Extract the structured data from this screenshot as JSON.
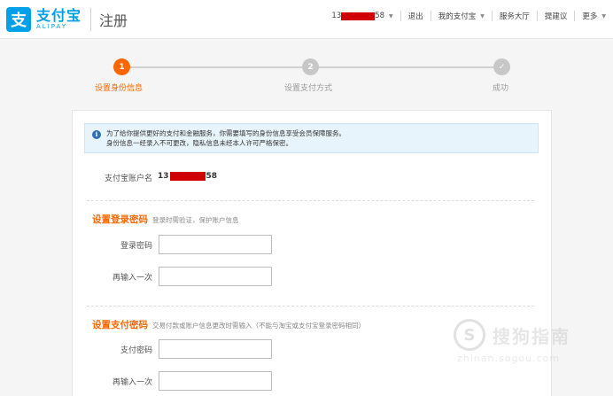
{
  "header": {
    "logo_cn": "支付宝",
    "logo_en": "ALIPAY",
    "page_title": "注册",
    "account_prefix": "13",
    "account_suffix": "58",
    "logout": "退出",
    "my_alipay": "我的支付宝",
    "service_hall": "服务大厅",
    "suggestion": "提建议",
    "more": "更多"
  },
  "steps": [
    {
      "num": "1",
      "label": "设置身份信息",
      "state": "active"
    },
    {
      "num": "2",
      "label": "设置支付方式",
      "state": "idle"
    },
    {
      "num": "✓",
      "label": "成功",
      "state": "idle"
    }
  ],
  "notice": {
    "line1": "为了给你提供更好的支付和金融服务，你需要填写的身份信息享受会员保障服务。",
    "line2": "身份信息一经录入不可更改，隐私信息未经本人许可严格保密。"
  },
  "account": {
    "label": "支付宝账户名",
    "prefix": "13",
    "suffix": "58"
  },
  "login_section": {
    "title": "设置登录密码",
    "subtitle": "登录时需验证，保护账户信息",
    "password_label": "登录密码",
    "confirm_label": "再输入一次"
  },
  "pay_section": {
    "title": "设置支付密码",
    "subtitle": "交易付款或账户信息更改时需输入（不能与淘宝或支付宝登录密码相同）",
    "password_label": "支付密码",
    "confirm_label": "再输入一次"
  },
  "watermark": {
    "text": "搜狗指南",
    "url": "zhinan.sogou.com"
  },
  "colors": {
    "brand": "#00a0e9",
    "accent": "#ff6600",
    "redaction": "#d10000"
  }
}
